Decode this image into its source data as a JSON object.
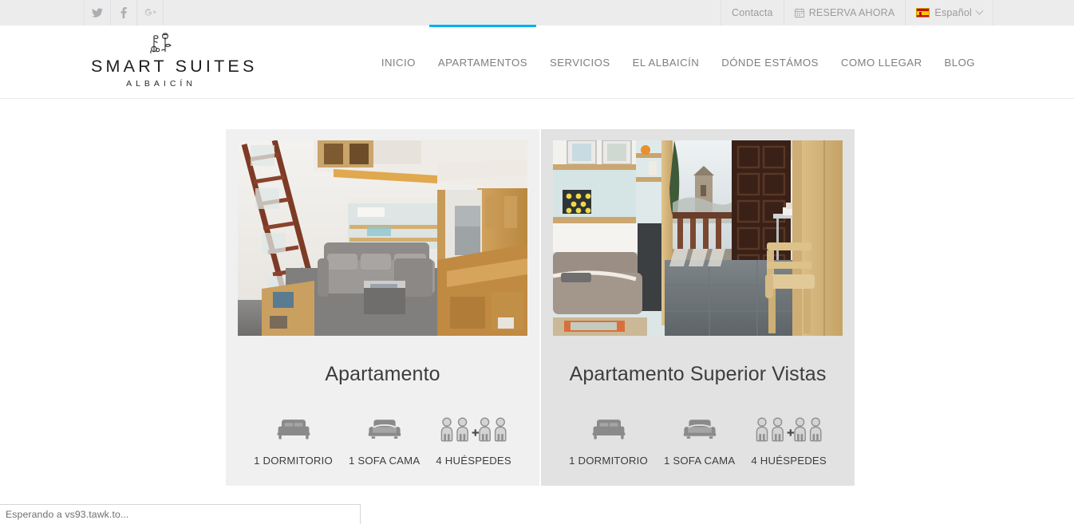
{
  "theme": {
    "accent": "#00b0ed",
    "topbar_bg": "#ececec",
    "card1_bg": "#f0f0f0",
    "card2_bg": "#e2e2e2",
    "text_muted": "#9b9b9b",
    "text_dark": "#3d3d3d",
    "icon_gray": "#8a8a8a"
  },
  "topbar": {
    "social": [
      {
        "name": "twitter",
        "label": "Twitter"
      },
      {
        "name": "facebook",
        "label": "Facebook"
      },
      {
        "name": "google-plus",
        "label": "Google Plus"
      }
    ],
    "contact_label": "Contacta",
    "booking_label": "RESERVA AHORA",
    "booking_icon": "calendar-icon",
    "language_label": "Español",
    "language_flag": "spain-flag-icon",
    "language_chevron": "chevron-down-icon"
  },
  "header": {
    "logo": {
      "name": "SMART SUITES",
      "subtitle": "ALBAICÍN",
      "ornament": "floral-key-ornament"
    },
    "nav": [
      {
        "label": "INICIO",
        "active": false
      },
      {
        "label": "APARTAMENTOS",
        "active": true
      },
      {
        "label": "SERVICIOS",
        "active": false
      },
      {
        "label": "EL ALBAICÍN",
        "active": false
      },
      {
        "label": "DÓNDE ESTÁMOS",
        "active": false
      },
      {
        "label": "COMO LLEGAR",
        "active": false
      },
      {
        "label": "BLOG",
        "active": false
      }
    ]
  },
  "main": {
    "cards": [
      {
        "title": "Apartamento",
        "photo_alt": "Interior de loft con escalera de madera, sofá gris y cocina abierta",
        "features": [
          {
            "icon": "bed-icon",
            "label": "1 DORMITORIO"
          },
          {
            "icon": "sofa-icon",
            "label": "1 SOFA CAMA"
          },
          {
            "icon": "guests-icon",
            "label": "4 HUÉSPEDES"
          }
        ]
      },
      {
        "title": "Apartamento Superior Vistas",
        "photo_alt": "Salón con balcón y vistas a torre, puerta de madera oscura y silla",
        "features": [
          {
            "icon": "bed-icon",
            "label": "1 DORMITORIO"
          },
          {
            "icon": "sofa-icon",
            "label": "1 SOFA CAMA"
          },
          {
            "icon": "guests-icon",
            "label": "4 HUÉSPEDES"
          }
        ]
      }
    ]
  },
  "statusbar": {
    "text": "Esperando a vs93.tawk.to..."
  }
}
